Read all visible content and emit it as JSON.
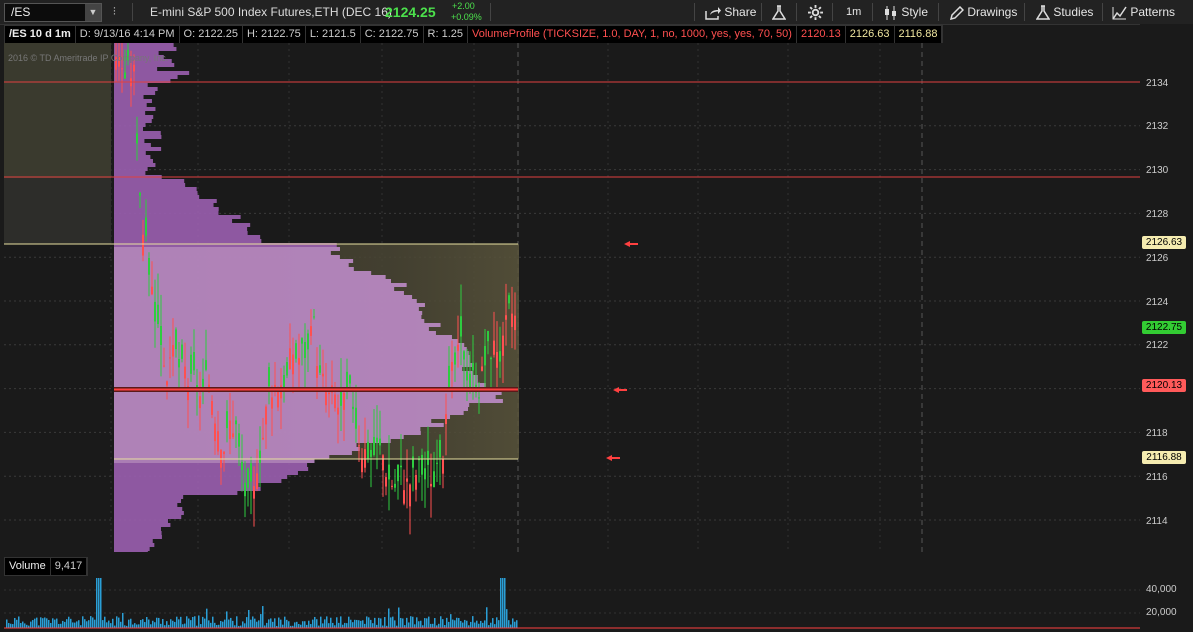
{
  "toolbar": {
    "symbol": "/ES",
    "description": "E-mini S&P 500 Index Futures,ETH (DEC 16)",
    "last_price": "2124.25",
    "change": "+2.00",
    "change_pct": "+0.09%",
    "share": "Share",
    "timeframe": "1m",
    "style": "Style",
    "drawings": "Drawings",
    "studies": "Studies",
    "patterns": "Patterns"
  },
  "info": {
    "chart_label": "/ES 10 d 1m",
    "date": "D: 9/13/16 4:14 PM",
    "open": "O: 2122.25",
    "high": "H: 2122.75",
    "low": "L: 2121.5",
    "close": "C: 2122.75",
    "range": "R: 1.25",
    "study": "VolumeProfile (TICKSIZE, 1.0, DAY, 1, no, 1000, yes, yes, 70, 50)",
    "poc": "2120.13",
    "vah": "2126.63",
    "val": "2116.88"
  },
  "watermark": "2016 © TD Ameritrade IP Company, Inc.",
  "price_axis": {
    "ticks": [
      "2134",
      "2132",
      "2130",
      "2128",
      "2126",
      "2124",
      "2122",
      "2120",
      "2118",
      "2116",
      "2114"
    ],
    "tags": {
      "vah": "2126.63",
      "last": "2122.75",
      "poc": "2120.13",
      "val": "2116.88"
    }
  },
  "volume": {
    "label": "Volume",
    "value": "9,417",
    "ticks": [
      "40,000",
      "20,000"
    ]
  },
  "colors": {
    "up": "#2ecc40",
    "down": "#ff5050",
    "profile": "#9b5fb0",
    "value_area": "#c48fd0",
    "accent_last": "#3c3",
    "poc": "#ff4040",
    "va_line": "#e8e0a0"
  }
}
